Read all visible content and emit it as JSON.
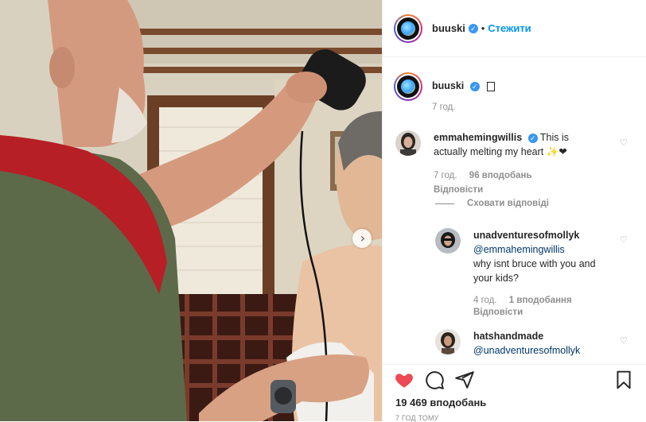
{
  "header": {
    "username": "buuski",
    "separator": "•",
    "follow_label": "Стежити"
  },
  "caption": {
    "username": "buuski",
    "time": "7 год."
  },
  "comments": [
    {
      "username": "emmahemingwillis",
      "text": "This is actually melting my heart ✨❤",
      "time": "7 год.",
      "likes": "96 вподобань",
      "reply_label": "Відповісти"
    }
  ],
  "hide_replies_label": "Сховати відповіді",
  "replies": [
    {
      "username": "unadventuresofmollyk",
      "mention": "@emmahemingwillis",
      "text": "why isnt bruce with you and your kids?",
      "time": "4 год.",
      "likes": "1 вподобання",
      "reply_label": "Відповісти"
    },
    {
      "username": "hatshandmade",
      "mention": "@unadventuresofmollyk"
    }
  ],
  "footer": {
    "likes_count": "19 469 вподобань",
    "post_time": "7 ГОД ТОМУ"
  },
  "icons": [
    "heart-filled-icon",
    "comment-icon",
    "share-icon",
    "bookmark-icon",
    "verified-icon",
    "next-arrow-icon",
    "like-comment-icon"
  ],
  "colors": {
    "accent": "#0095f6",
    "like_red": "#ed4956",
    "muted": "#8e8e8e",
    "verified": "#3897f0"
  }
}
